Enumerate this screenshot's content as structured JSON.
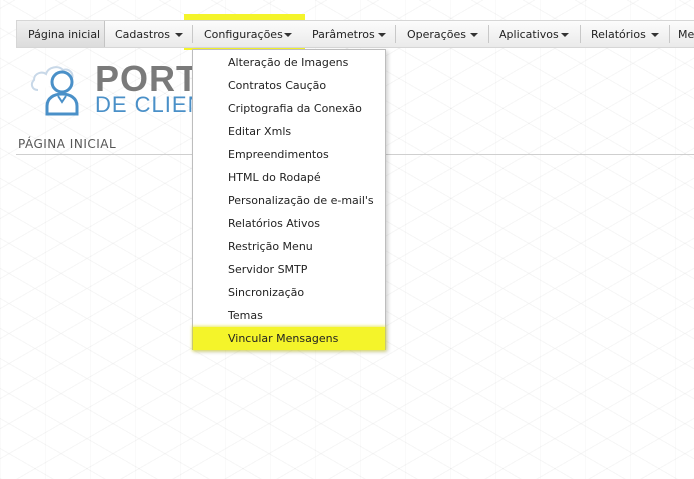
{
  "menu": {
    "items": [
      {
        "label": "Página inicial"
      },
      {
        "label": "Cadastros"
      },
      {
        "label": "Configurações"
      },
      {
        "label": "Parâmetros"
      },
      {
        "label": "Operações"
      },
      {
        "label": "Aplicativos"
      },
      {
        "label": "Relatórios"
      },
      {
        "label": "Mer"
      }
    ]
  },
  "logo": {
    "line1": "PORTA",
    "line2": "DE CLIENT"
  },
  "page": {
    "title": "PÁGINA INICIAL"
  },
  "dropdown": {
    "items": [
      {
        "label": "Alteração de Imagens"
      },
      {
        "label": "Contratos Caução"
      },
      {
        "label": "Criptografia da Conexão"
      },
      {
        "label": "Editar Xmls"
      },
      {
        "label": "Empreendimentos"
      },
      {
        "label": "HTML do Rodapé"
      },
      {
        "label": "Personalização de e-mail's"
      },
      {
        "label": "Relatórios Ativos"
      },
      {
        "label": "Restrição Menu"
      },
      {
        "label": "Servidor SMTP"
      },
      {
        "label": "Sincronização"
      },
      {
        "label": "Temas"
      },
      {
        "label": "Vincular Mensagens"
      }
    ],
    "highlighted_item": "Vincular Mensagens"
  },
  "colors": {
    "highlight": "#f4f42a",
    "logo_gray": "#7a7a7a",
    "logo_blue": "#4a90c8"
  }
}
